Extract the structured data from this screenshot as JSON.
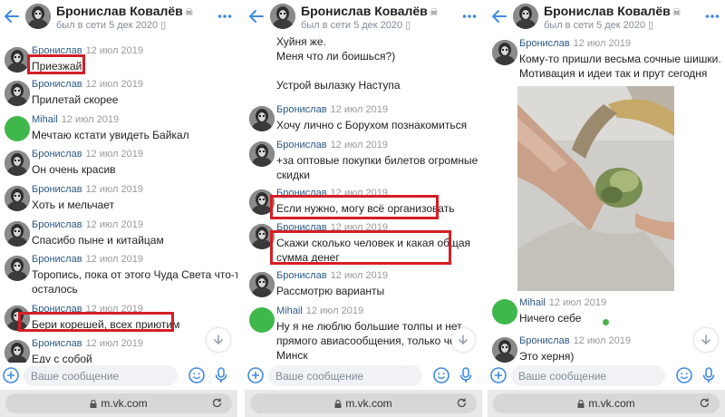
{
  "header": {
    "name": "Брониcлав Ковалёв",
    "skull": "☠",
    "status": "был в сети 5 дек 2020 ▯"
  },
  "footer": {
    "placeholder": "Ваше сообщение"
  },
  "browser": {
    "url": "m.vk.com"
  },
  "panels": [
    {
      "messages": [
        {
          "sender": "Бронислав",
          "time": "12 июл 2019",
          "lines": [
            "Приезжай)"
          ]
        },
        {
          "sender": "Бронислав",
          "time": "12 июл 2019",
          "lines": [
            "Прилетай скорее"
          ]
        },
        {
          "sender": "Mihail",
          "time": "12 июл 2019",
          "lines": [
            "Мечтаю кстати увидеть Байкал"
          ]
        },
        {
          "sender": "Бронислав",
          "time": "12 июл 2019",
          "lines": [
            "Он очень красив"
          ]
        },
        {
          "sender": "Бронислав",
          "time": "12 июл 2019",
          "lines": [
            "Хоть и мельчает"
          ]
        },
        {
          "sender": "Бронислав",
          "time": "12 июл 2019",
          "lines": [
            "Спасибо пыне и китайцам"
          ]
        },
        {
          "sender": "Бронислав",
          "time": "12 июл 2019",
          "lines": [
            "Торопись, пока от этого Чуда Света что-то",
            "осталось"
          ]
        },
        {
          "sender": "Бронислав",
          "time": "12 июл 2019",
          "lines": [
            "Бери корешей, всех приютим"
          ]
        },
        {
          "sender": "Бронислав",
          "time": "12 июл 2019",
          "lines": [
            "Еду с собой"
          ]
        }
      ]
    },
    {
      "messages": [
        {
          "sender": "",
          "time": "",
          "lines": [
            "Хуйня же.",
            "Меня что ли боишься?)",
            "",
            "Устрой вылазку Наступа"
          ]
        },
        {
          "sender": "Бронислав",
          "time": "12 июл 2019",
          "lines": [
            "Хочу лично с Борухом познакомиться"
          ]
        },
        {
          "sender": "Бронислав",
          "time": "12 июл 2019",
          "lines": [
            "+за оптовые покупки билетов огромные",
            "скидки"
          ]
        },
        {
          "sender": "Бронислав",
          "time": "12 июл 2019",
          "lines": [
            "Если нужно, могу всё организовать"
          ]
        },
        {
          "sender": "Бронислав",
          "time": "12 июл 2019",
          "lines": [
            "Скажи сколько человек и какая общая",
            "сумма денег"
          ]
        },
        {
          "sender": "Бронислав",
          "time": "12 июл 2019",
          "lines": [
            "Рассмотрю варианты"
          ]
        },
        {
          "sender": "Mihail",
          "time": "12 июл 2019",
          "lines": [
            "Ну я не люблю большие толпы и нет",
            "прямого авиасообщения, только через",
            "Минск"
          ]
        }
      ]
    },
    {
      "messages": [
        {
          "sender": "Бронислав",
          "time": "12 июл 2019",
          "lines": [
            "Кому-то пришли весьма сочные шишки.",
            "Мотивация и идеи так и прут сегодня"
          ]
        },
        {
          "sender": "Mihail",
          "time": "12 июл 2019",
          "lines": [
            "Ничего себе"
          ]
        },
        {
          "sender": "Бронислав",
          "time": "12 июл 2019",
          "lines": [
            "Это херня)"
          ]
        }
      ]
    }
  ],
  "colors": {
    "highlight": "#d51e25",
    "link": "#2a5885",
    "accent": "#3f8ae0",
    "online": "#4bb34b"
  }
}
